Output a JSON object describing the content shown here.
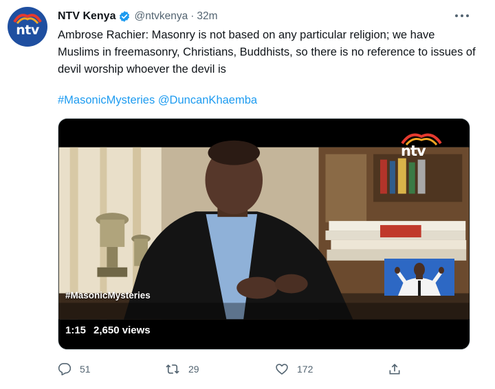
{
  "tweet": {
    "author": {
      "display_name": "NTV Kenya",
      "handle": "@ntvkenya",
      "verified": true,
      "avatar_icon": "ntv-logo-icon",
      "avatar_text": "ntv"
    },
    "separator": "·",
    "timestamp": "32m",
    "text": "Ambrose Rachier: Masonry is not based on any particular religion; we have Muslims in freemasonry, Christians, Buddhists, so there is no reference to issues of devil worship whoever the devil is",
    "hashtag": "#MasonicMysteries",
    "mention": "@DuncanKhaemba"
  },
  "media": {
    "watermark": "ntv",
    "overlay_hashtag": "#MasonicMysteries",
    "duration": "1:15",
    "views": "2,650 views"
  },
  "actions": {
    "replies": "51",
    "retweets": "29",
    "likes": "172"
  },
  "colors": {
    "link": "#1d9bf0",
    "verified_badge": "#1d9bf0",
    "muted_text": "#536471",
    "primary_text": "#0f1419"
  },
  "icons": [
    "ntv-logo-icon",
    "verified-badge-icon",
    "more-options-icon",
    "reply-icon",
    "retweet-icon",
    "like-icon",
    "share-icon",
    "sign-language-interpreter-icon"
  ]
}
